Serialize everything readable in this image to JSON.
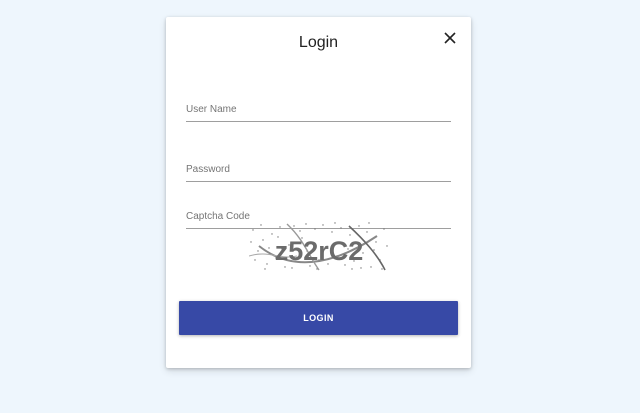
{
  "dialog": {
    "title": "Login",
    "close_icon": "close-icon"
  },
  "form": {
    "username_placeholder": "User Name",
    "password_placeholder": "Password",
    "captcha_placeholder": "Captcha Code",
    "captcha_text": "z52rC2",
    "login_label": "LOGIN"
  },
  "colors": {
    "page_background": "#eef6fd",
    "button": "#3749a6",
    "button_text": "#ffffff"
  }
}
